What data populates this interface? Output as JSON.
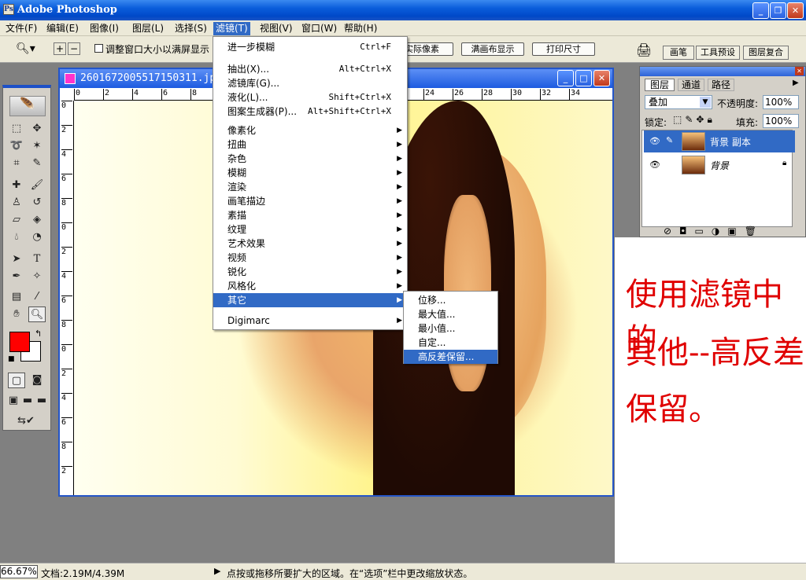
{
  "app": {
    "title": "Adobe Photoshop"
  },
  "menubar": {
    "items": [
      "文件(F)",
      "编辑(E)",
      "图像(I)",
      "图层(L)",
      "选择(S)",
      "滤镜(T)",
      "视图(V)",
      "窗口(W)",
      "帮助(H)"
    ]
  },
  "options": {
    "checkbox_label": "调整窗口大小以满屏显示",
    "btn_actual": "实际像素",
    "btn_fit": "满画布显示",
    "btn_print": "打印尺寸",
    "tab_brush": "画笔",
    "tab_tool_presets": "工具预设",
    "tab_layer_comps": "图层复合"
  },
  "document": {
    "title": "2601672005517150311.jp",
    "ruler_h": [
      "0",
      "2",
      "4",
      "6",
      "8",
      "",
      "",
      "",
      "",
      "",
      "",
      "22",
      "24",
      "26",
      "28",
      "30",
      "32",
      "34"
    ],
    "ruler_v": [
      "0",
      "2",
      "4",
      "6",
      "8",
      "0",
      "2",
      "4",
      "6",
      "8",
      "0",
      "2",
      "4",
      "6",
      "8",
      "2"
    ]
  },
  "filter_menu": {
    "items": [
      {
        "label": "进一步模糊",
        "shortcut": "Ctrl+F"
      },
      {
        "label": "抽出(X)...",
        "shortcut": "Alt+Ctrl+X"
      },
      {
        "label": "滤镜库(G)...",
        "shortcut": ""
      },
      {
        "label": "液化(L)...",
        "shortcut": "Shift+Ctrl+X"
      },
      {
        "label": "图案生成器(P)...",
        "shortcut": "Alt+Shift+Ctrl+X"
      },
      {
        "label": "像素化"
      },
      {
        "label": "扭曲"
      },
      {
        "label": "杂色"
      },
      {
        "label": "模糊"
      },
      {
        "label": "渲染"
      },
      {
        "label": "画笔描边"
      },
      {
        "label": "素描"
      },
      {
        "label": "纹理"
      },
      {
        "label": "艺术效果"
      },
      {
        "label": "视频"
      },
      {
        "label": "锐化"
      },
      {
        "label": "风格化"
      },
      {
        "label": "其它"
      },
      {
        "label": "Digimarc"
      }
    ]
  },
  "other_submenu": {
    "items": [
      "位移...",
      "最大值...",
      "最小值...",
      "自定...",
      "高反差保留..."
    ]
  },
  "layers_panel": {
    "tabs": [
      "图层",
      "通道",
      "路径"
    ],
    "blend_mode": "叠加",
    "opacity_label": "不透明度:",
    "opacity": "100%",
    "lock_label": "锁定:",
    "fill_label": "填充:",
    "fill": "100%",
    "layers": [
      "背景 副本",
      "背景"
    ]
  },
  "annotation": {
    "line1": "使用滤镜中的",
    "line2": "其他--高反差",
    "line3": "保留。"
  },
  "status": {
    "zoom": "66.67%",
    "doc": "文档:2.19M/4.39M",
    "hint": "点按或拖移所要扩大的区域。在“选项”栏中更改缩放状态。"
  },
  "colors": {
    "foreground": "#ff0000",
    "selection": "#316ac5",
    "annotation": "#e00000"
  }
}
